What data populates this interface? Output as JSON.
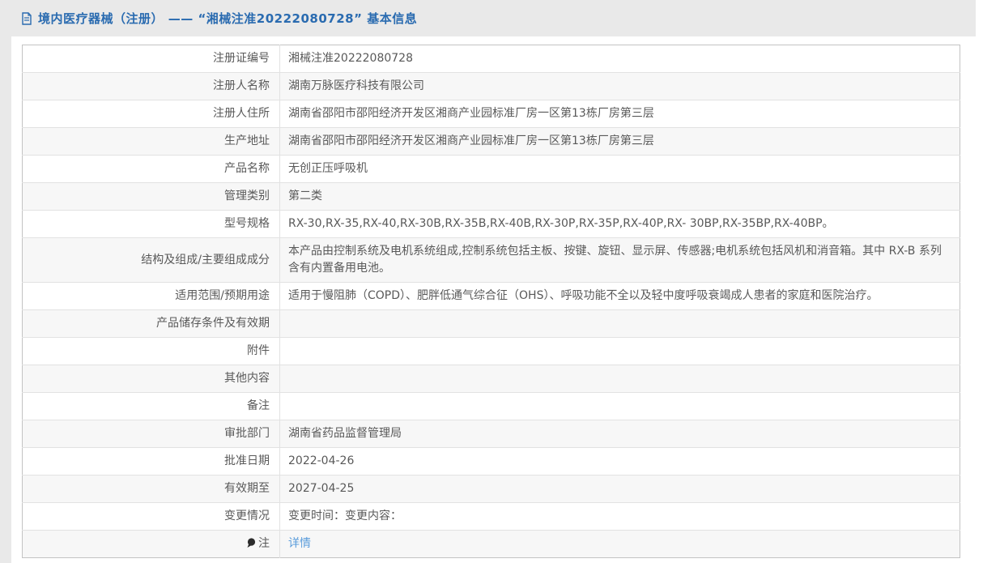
{
  "page": {
    "header": {
      "icon": "document-icon",
      "title": "境内医疗器械（注册） —— “湘械注准20222080728” 基本信息"
    },
    "colors": {
      "title_blue": "#2a6bb0",
      "link_blue": "#5a9cdb",
      "page_background": "#e9e9e9",
      "row_stripe": "#f7f7f7",
      "text_gray": "#595959",
      "border_gray": "#c3c3c3"
    },
    "table": {
      "rows": [
        {
          "label": "注册证编号",
          "value": "湘械注准20222080728"
        },
        {
          "label": "注册人名称",
          "value": "湖南万脉医疗科技有限公司"
        },
        {
          "label": "注册人住所",
          "value": "湖南省邵阳市邵阳经济开发区湘商产业园标准厂房一区第13栋厂房第三层"
        },
        {
          "label": "生产地址",
          "value": "湖南省邵阳市邵阳经济开发区湘商产业园标准厂房一区第13栋厂房第三层"
        },
        {
          "label": "产品名称",
          "value": "无创正压呼吸机"
        },
        {
          "label": "管理类别",
          "value": "第二类"
        },
        {
          "label": "型号规格",
          "value": "RX-30,RX-35,RX-40,RX-30B,RX-35B,RX-40B,RX-30P,RX-35P,RX-40P,RX- 30BP,RX-35BP,RX-40BP。"
        },
        {
          "label": "结构及组成/主要组成成分",
          "value": "本产品由控制系统及电机系统组成,控制系统包括主板、按键、旋钮、显示屏、传感器;电机系统包括风机和消音箱。其中 RX-B 系列含有内置备用电池。"
        },
        {
          "label": "适用范围/预期用途",
          "value": "适用于慢阻肺（COPD）、肥胖低通气综合征（OHS）、呼吸功能不全以及轻中度呼吸衰竭成人患者的家庭和医院治疗。"
        },
        {
          "label": "产品储存条件及有效期",
          "value": ""
        },
        {
          "label": "附件",
          "value": ""
        },
        {
          "label": "其他内容",
          "value": ""
        },
        {
          "label": "备注",
          "value": ""
        },
        {
          "label": "审批部门",
          "value": "湖南省药品监督管理局"
        },
        {
          "label": "批准日期",
          "value": "2022-04-26"
        },
        {
          "label": "有效期至",
          "value": "2027-04-25"
        },
        {
          "label": "变更情况",
          "value": "变更时间：变更内容："
        },
        {
          "label": "注",
          "label_icon": "speech-balloon-icon",
          "value": "详情",
          "value_is_link": true
        }
      ]
    }
  }
}
